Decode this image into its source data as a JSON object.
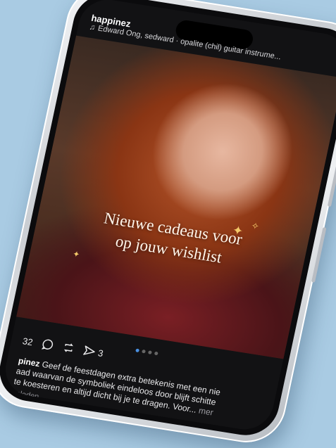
{
  "post": {
    "account": "happinez",
    "music": "Edward Ong, sedward · opalite (chil) guitar instrume...",
    "overlay_line1": "Nieuwe cadeaus voor",
    "overlay_line2": "op jouw wishlist",
    "likes": "32",
    "shares": "3",
    "caption_user": "pinez",
    "caption_line1": "Geef de feestdagen extra betekenis met een nie",
    "caption_line2": "aad waarvan de symboliek eindeloos door blijft schitte",
    "caption_line3": "te koesteren en altijd dicht bij je te dragen. Voor...",
    "more_label": "mer",
    "timestamp": "geleden",
    "dots_total": 4,
    "dots_active": 1
  },
  "colors": {
    "background": "#a9cbe3",
    "accent": "#4a90e2"
  },
  "icons": [
    "music-note-icon",
    "comment-icon",
    "repost-icon",
    "share-icon",
    "sparkle-icon"
  ]
}
